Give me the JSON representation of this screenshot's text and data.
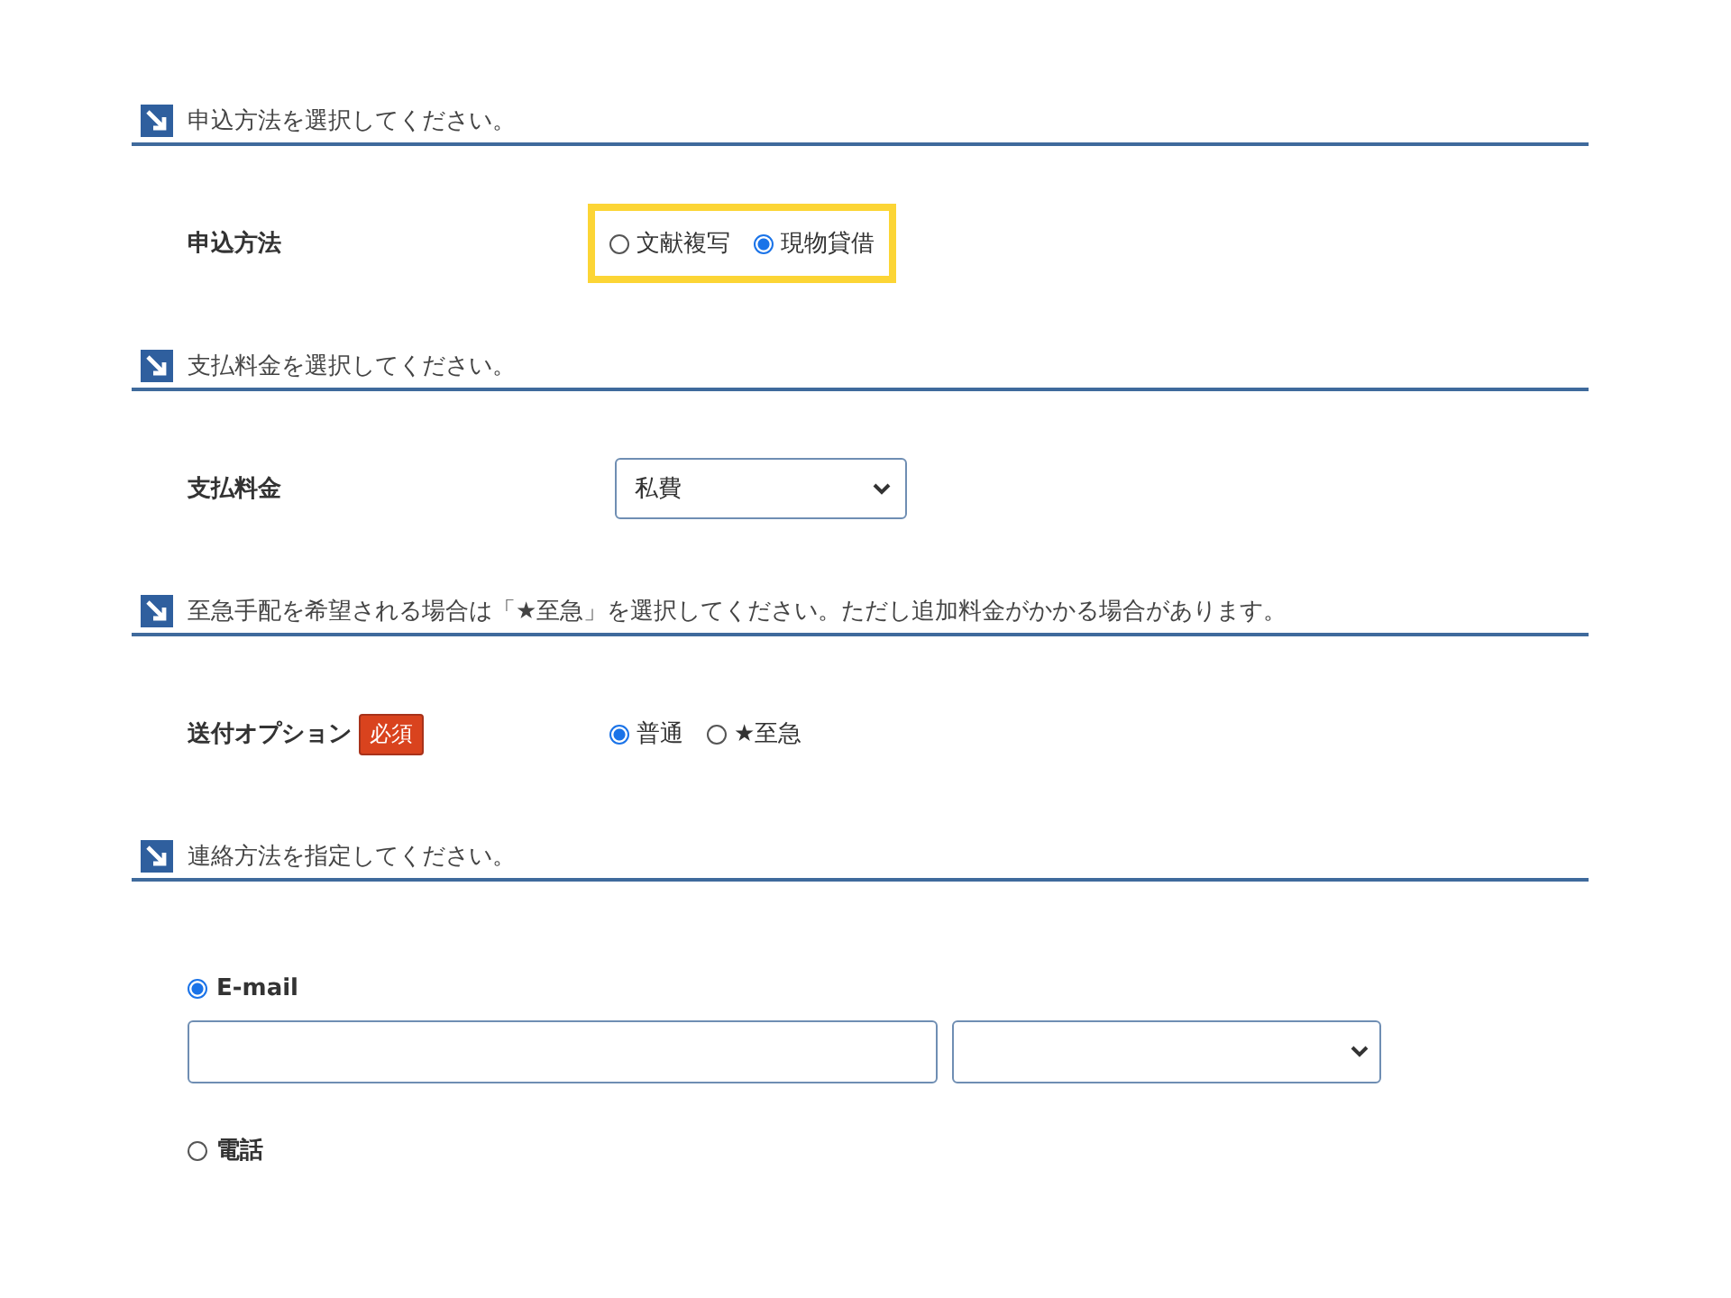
{
  "sections": [
    {
      "heading": "申込方法を選択してください。",
      "kind": "radio",
      "label": "申込方法",
      "highlighted": true,
      "options": [
        {
          "label": "文献複写",
          "selected": false
        },
        {
          "label": "現物貸借",
          "selected": true
        }
      ]
    },
    {
      "heading": "支払料金を選択してください。",
      "kind": "select",
      "label": "支払料金",
      "value": "私費"
    },
    {
      "heading": "至急手配を希望される場合は「★至急」を選択してください。ただし追加料金がかかる場合があります。",
      "kind": "radio",
      "label": "送付オプション",
      "badge": "必須",
      "highlighted": false,
      "options": [
        {
          "label": "普通",
          "selected": true
        },
        {
          "label": "★至急",
          "selected": false
        }
      ]
    },
    {
      "heading": "連絡方法を指定してください。",
      "kind": "contact",
      "methods": [
        {
          "kind": "email",
          "label": "E-mail",
          "selected": true
        },
        {
          "kind": "phone",
          "label": "電話",
          "selected": false
        }
      ]
    }
  ]
}
